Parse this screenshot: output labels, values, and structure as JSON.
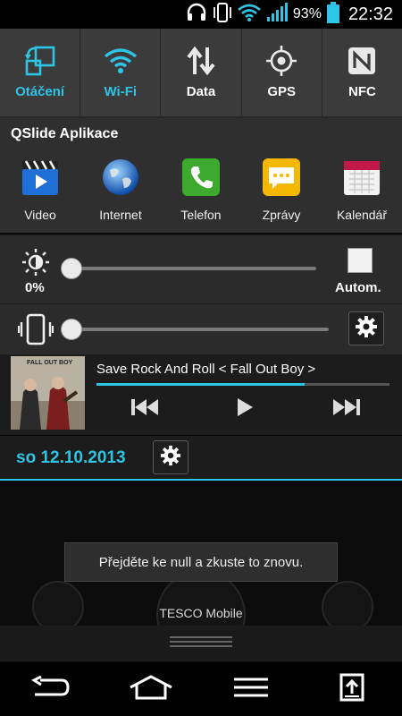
{
  "status_bar": {
    "battery_percent": "93%",
    "time": "22:32",
    "icons": [
      "headset-icon",
      "vibrate-icon",
      "wifi-icon",
      "signal-icon",
      "battery-icon"
    ]
  },
  "quick_toggles": [
    {
      "label": "Otáčení",
      "icon": "rotation-icon",
      "active": true
    },
    {
      "label": "Wi-Fi",
      "icon": "wifi-icon",
      "active": true
    },
    {
      "label": "Data",
      "icon": "data-arrows-icon",
      "active": false
    },
    {
      "label": "GPS",
      "icon": "gps-icon",
      "active": false
    },
    {
      "label": "NFC",
      "icon": "nfc-icon",
      "active": false
    }
  ],
  "qslide": {
    "title": "QSlide Aplikace",
    "apps": [
      {
        "label": "Video",
        "icon": "video-icon"
      },
      {
        "label": "Internet",
        "icon": "globe-icon"
      },
      {
        "label": "Telefon",
        "icon": "phone-icon"
      },
      {
        "label": "Zprávy",
        "icon": "message-icon"
      },
      {
        "label": "Kalendář",
        "icon": "calendar-icon"
      }
    ]
  },
  "brightness": {
    "value_label": "0%",
    "level": 0,
    "auto_label": "Autom."
  },
  "volume": {
    "level": 0
  },
  "music": {
    "title": "Save Rock And Roll < Fall Out Boy >",
    "progress": 0.71,
    "album_text": "FALL OUT BOY"
  },
  "date": {
    "text": "so 12.10.2013"
  },
  "toast": {
    "text": "Přejděte ke null a zkuste to znovu."
  },
  "carrier": {
    "text": "TESCO Mobile"
  },
  "colors": {
    "accent": "#2ec4e6",
    "panel": "#3b3b3b"
  }
}
